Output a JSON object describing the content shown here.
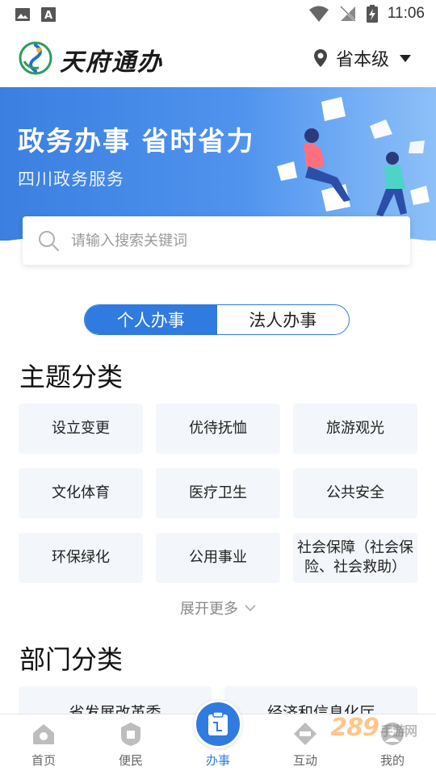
{
  "status_bar": {
    "time": "11:06"
  },
  "header": {
    "app_title": "天府通办",
    "region": "省本级"
  },
  "banner": {
    "title": "政务办事  省时省力",
    "subtitle": "四川政务服务"
  },
  "search": {
    "placeholder": "请输入搜索关键词"
  },
  "mode_tabs": [
    {
      "label": "个人办事",
      "active": true
    },
    {
      "label": "法人办事",
      "active": false
    }
  ],
  "topics": {
    "title": "主题分类",
    "items": [
      "设立变更",
      "优待抚恤",
      "旅游观光",
      "文化体育",
      "医疗卫生",
      "公共安全",
      "环保绿化",
      "公用事业",
      "社会保障（社会保险、社会救助）"
    ],
    "more_label": "展开更多"
  },
  "departments": {
    "title": "部门分类",
    "items": [
      "省发展改革委",
      "经济和信息化厅"
    ]
  },
  "bottom_nav": [
    {
      "label": "首页",
      "icon": "home-icon"
    },
    {
      "label": "便民",
      "icon": "service-icon"
    },
    {
      "label": "办事",
      "icon": "affairs-icon",
      "active": true
    },
    {
      "label": "互动",
      "icon": "interact-icon"
    },
    {
      "label": "我的",
      "icon": "profile-icon"
    }
  ],
  "watermark": {
    "text": "289",
    "suffix": "手游网"
  },
  "colors": {
    "primary": "#2f7be0",
    "banner_start": "#3b7fe0",
    "banner_end": "#8dc0f8",
    "cell_bg": "#f3f6fa"
  }
}
